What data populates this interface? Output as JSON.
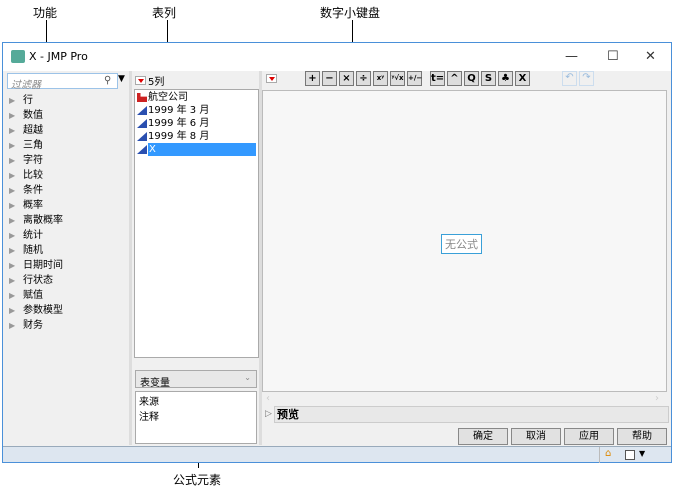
{
  "callouts": {
    "functions": "功能",
    "columns": "表列",
    "keypad": "数字小键盘",
    "elements": "公式元素"
  },
  "window": {
    "title": "X - JMP Pro"
  },
  "left": {
    "filter_placeholder": "过滤器",
    "items": [
      "行",
      "数值",
      "超越",
      "三角",
      "字符",
      "比较",
      "条件",
      "概率",
      "离散概率",
      "统计",
      "随机",
      "日期时间",
      "行状态",
      "赋值",
      "参数模型",
      "财务"
    ]
  },
  "columns": {
    "header": "5列",
    "items": [
      "航空公司",
      "1999 年 3 月",
      "1999 年 6 月",
      "1999 年 8 月",
      "X"
    ]
  },
  "elements": {
    "dropdown": "表变量",
    "items": [
      "来源",
      "注释"
    ]
  },
  "keypad": {
    "buttons": [
      "+",
      "−",
      "×",
      "÷",
      "xʸ",
      "ʸ√x",
      "+∕−",
      "t=",
      "^",
      "Q",
      "S",
      "♣",
      "X"
    ]
  },
  "formula": {
    "empty_text": "无公式",
    "preview_label": "预览"
  },
  "buttons": {
    "ok": "确定",
    "cancel": "取消",
    "apply": "应用",
    "help": "帮助"
  }
}
